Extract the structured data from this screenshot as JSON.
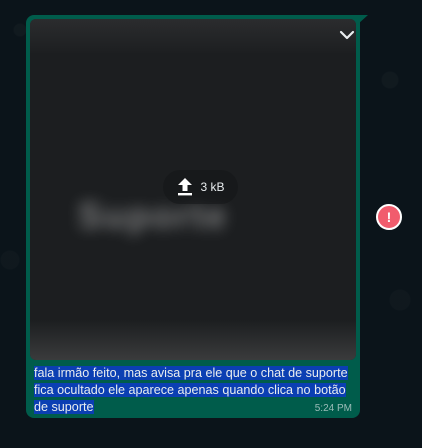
{
  "message": {
    "attachment": {
      "size_label": "3 kB",
      "blurred_preview_text": "Suporte",
      "upload_icon": "upload-arrow-icon",
      "menu_icon": "chevron-down-icon"
    },
    "caption": "fala irmão feito, mas avisa pra ele que o chat de suporte fica ocultado ele aparece apenas quando clica no botão de suporte",
    "time": "5:24 PM",
    "status_icon": "error-icon",
    "status_symbol": "!"
  },
  "colors": {
    "background": "#0b141a",
    "bubble": "#005c4b",
    "selection": "#0b3fb3",
    "error": "#f15c6d"
  }
}
